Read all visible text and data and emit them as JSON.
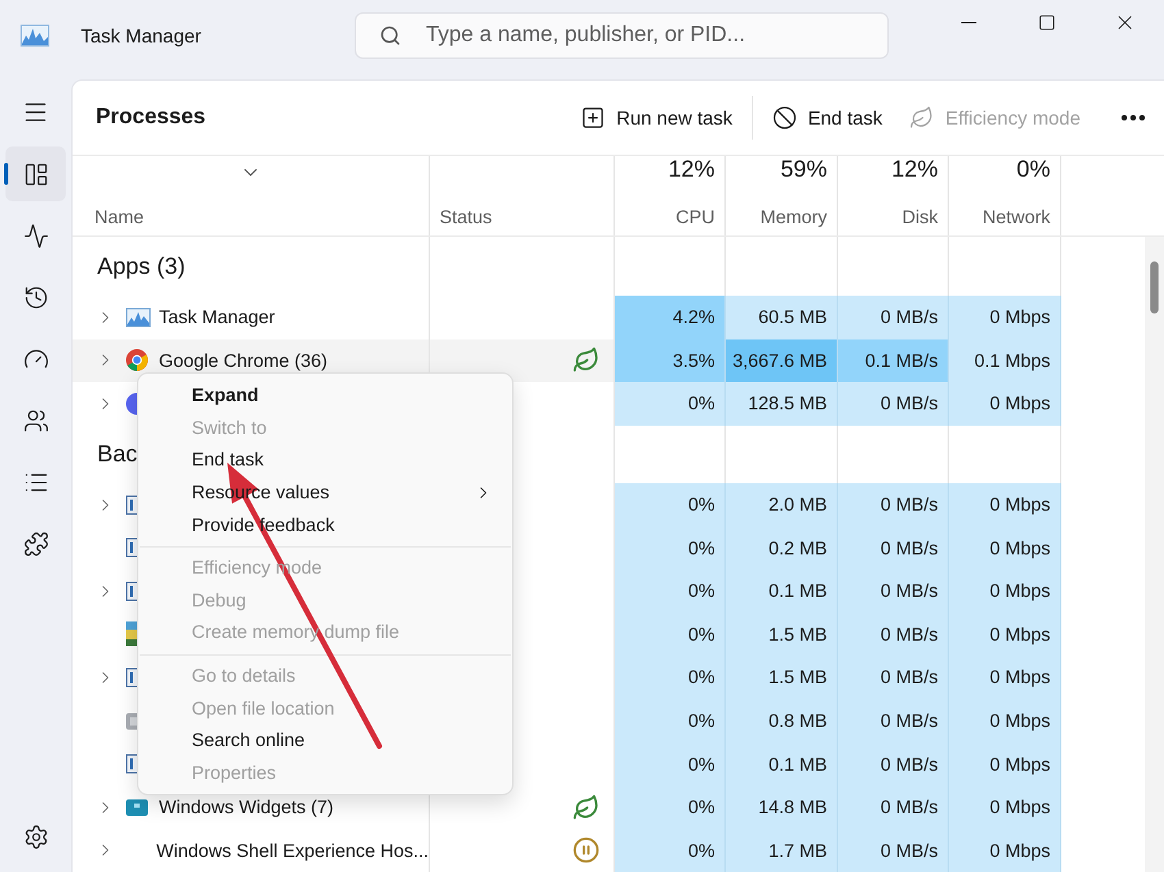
{
  "window": {
    "title": "Task Manager"
  },
  "search": {
    "placeholder": "Type a name, publisher, or PID..."
  },
  "sidebar": {
    "items": [
      {
        "kind": "processes",
        "selected": true
      },
      {
        "kind": "performance",
        "selected": false
      },
      {
        "kind": "history",
        "selected": false
      },
      {
        "kind": "startup",
        "selected": false
      },
      {
        "kind": "users",
        "selected": false
      },
      {
        "kind": "details",
        "selected": false
      },
      {
        "kind": "services",
        "selected": false
      }
    ]
  },
  "toolbar": {
    "title": "Processes",
    "actions": [
      {
        "kind": "run",
        "label": "Run new task",
        "disabled": false
      },
      {
        "kind": "end",
        "label": "End task",
        "disabled": false
      },
      {
        "kind": "efficiency",
        "label": "Efficiency mode",
        "disabled": true
      }
    ]
  },
  "table": {
    "columns": [
      {
        "kind": "name",
        "label": "Name"
      },
      {
        "kind": "status",
        "label": "Status"
      },
      {
        "kind": "metric",
        "percent": "12%",
        "label": "CPU"
      },
      {
        "kind": "metric",
        "percent": "59%",
        "label": "Memory"
      },
      {
        "kind": "metric",
        "percent": "12%",
        "label": "Disk"
      },
      {
        "kind": "metric",
        "percent": "0%",
        "label": "Network"
      }
    ],
    "rows": [
      {
        "kind": "group",
        "label": "Apps (3)"
      },
      {
        "kind": "process",
        "name": "Task Manager",
        "expandable": true,
        "selected": false,
        "efficiency_mode": false,
        "suspended": false,
        "cells": [
          {
            "text": "4.2%",
            "color": "#92d4fa"
          },
          {
            "text": "60.5 MB",
            "color": "#cbe9fb"
          },
          {
            "text": "0 MB/s",
            "color": "#cbe9fb"
          },
          {
            "text": "0 Mbps",
            "color": "#cbe9fb"
          }
        ]
      },
      {
        "kind": "process",
        "name": "Google Chrome (36)",
        "expandable": true,
        "selected": true,
        "efficiency_mode": true,
        "suspended": false,
        "cells": [
          {
            "text": "3.5%",
            "color": "#92d4fa"
          },
          {
            "text": "3,667.6 MB",
            "color": "#6ec5f6"
          },
          {
            "text": "0.1 MB/s",
            "color": "#92d4fa"
          },
          {
            "text": "0.1 Mbps",
            "color": "#cbe9fb"
          }
        ]
      },
      {
        "kind": "process",
        "expandable": true,
        "selected": false,
        "efficiency_mode": false,
        "suspended": false,
        "cells": [
          {
            "text": "0%",
            "color": "#cbe9fb"
          },
          {
            "text": "128.5 MB",
            "color": "#cbe9fb"
          },
          {
            "text": "0 MB/s",
            "color": "#cbe9fb"
          },
          {
            "text": "0 Mbps",
            "color": "#cbe9fb"
          }
        ]
      },
      {
        "kind": "group",
        "label": "Bac"
      },
      {
        "kind": "process",
        "expandable": true,
        "selected": false,
        "efficiency_mode": false,
        "suspended": false,
        "cells": [
          {
            "text": "0%",
            "color": "#cbe9fb"
          },
          {
            "text": "2.0 MB",
            "color": "#cbe9fb"
          },
          {
            "text": "0 MB/s",
            "color": "#cbe9fb"
          },
          {
            "text": "0 Mbps",
            "color": "#cbe9fb"
          }
        ]
      },
      {
        "kind": "process",
        "expandable": false,
        "selected": false,
        "efficiency_mode": false,
        "suspended": false,
        "cells": [
          {
            "text": "0%",
            "color": "#cbe9fb"
          },
          {
            "text": "0.2 MB",
            "color": "#cbe9fb"
          },
          {
            "text": "0 MB/s",
            "color": "#cbe9fb"
          },
          {
            "text": "0 Mbps",
            "color": "#cbe9fb"
          }
        ]
      },
      {
        "kind": "process",
        "expandable": true,
        "selected": false,
        "efficiency_mode": false,
        "suspended": false,
        "cells": [
          {
            "text": "0%",
            "color": "#cbe9fb"
          },
          {
            "text": "0.1 MB",
            "color": "#cbe9fb"
          },
          {
            "text": "0 MB/s",
            "color": "#cbe9fb"
          },
          {
            "text": "0 Mbps",
            "color": "#cbe9fb"
          }
        ]
      },
      {
        "kind": "process",
        "expandable": false,
        "selected": false,
        "efficiency_mode": false,
        "suspended": false,
        "cells": [
          {
            "text": "0%",
            "color": "#cbe9fb"
          },
          {
            "text": "1.5 MB",
            "color": "#cbe9fb"
          },
          {
            "text": "0 MB/s",
            "color": "#cbe9fb"
          },
          {
            "text": "0 Mbps",
            "color": "#cbe9fb"
          }
        ]
      },
      {
        "kind": "process",
        "expandable": true,
        "selected": false,
        "efficiency_mode": false,
        "suspended": false,
        "cells": [
          {
            "text": "0%",
            "color": "#cbe9fb"
          },
          {
            "text": "1.5 MB",
            "color": "#cbe9fb"
          },
          {
            "text": "0 MB/s",
            "color": "#cbe9fb"
          },
          {
            "text": "0 Mbps",
            "color": "#cbe9fb"
          }
        ]
      },
      {
        "kind": "process",
        "expandable": false,
        "selected": false,
        "efficiency_mode": false,
        "suspended": false,
        "cells": [
          {
            "text": "0%",
            "color": "#cbe9fb"
          },
          {
            "text": "0.8 MB",
            "color": "#cbe9fb"
          },
          {
            "text": "0 MB/s",
            "color": "#cbe9fb"
          },
          {
            "text": "0 Mbps",
            "color": "#cbe9fb"
          }
        ]
      },
      {
        "kind": "process",
        "expandable": false,
        "selected": false,
        "efficiency_mode": false,
        "suspended": false,
        "cells": [
          {
            "text": "0%",
            "color": "#cbe9fb"
          },
          {
            "text": "0.1 MB",
            "color": "#cbe9fb"
          },
          {
            "text": "0 MB/s",
            "color": "#cbe9fb"
          },
          {
            "text": "0 Mbps",
            "color": "#cbe9fb"
          }
        ]
      },
      {
        "kind": "process",
        "name": "Windows Widgets (7)",
        "expandable": true,
        "selected": false,
        "efficiency_mode": true,
        "suspended": false,
        "cells": [
          {
            "text": "0%",
            "color": "#cbe9fb"
          },
          {
            "text": "14.8 MB",
            "color": "#cbe9fb"
          },
          {
            "text": "0 MB/s",
            "color": "#cbe9fb"
          },
          {
            "text": "0 Mbps",
            "color": "#cbe9fb"
          }
        ]
      },
      {
        "kind": "process",
        "name": "Windows Shell Experience Hos...",
        "expandable": true,
        "selected": false,
        "efficiency_mode": false,
        "suspended": true,
        "cells": [
          {
            "text": "0%",
            "color": "#cbe9fb"
          },
          {
            "text": "1.7 MB",
            "color": "#cbe9fb"
          },
          {
            "text": "0 MB/s",
            "color": "#cbe9fb"
          },
          {
            "text": "0 Mbps",
            "color": "#cbe9fb"
          }
        ]
      }
    ]
  },
  "context_menu": {
    "items": [
      {
        "kind": "item",
        "label": "Expand",
        "default": true,
        "disabled": false
      },
      {
        "kind": "item",
        "label": "Switch to",
        "default": false,
        "disabled": true
      },
      {
        "kind": "item",
        "label": "End task",
        "default": false,
        "disabled": false
      },
      {
        "kind": "item",
        "label": "Resource values",
        "default": false,
        "disabled": false,
        "submenu": true
      },
      {
        "kind": "item",
        "label": "Provide feedback",
        "default": false,
        "disabled": false
      },
      {
        "kind": "separator"
      },
      {
        "kind": "item",
        "label": "Efficiency mode",
        "default": false,
        "disabled": true
      },
      {
        "kind": "item",
        "label": "Debug",
        "default": false,
        "disabled": true
      },
      {
        "kind": "item",
        "label": "Create memory dump file",
        "default": false,
        "disabled": true
      },
      {
        "kind": "separator"
      },
      {
        "kind": "item",
        "label": "Go to details",
        "default": false,
        "disabled": true
      },
      {
        "kind": "item",
        "label": "Open file location",
        "default": false,
        "disabled": true
      },
      {
        "kind": "item",
        "label": "Search online",
        "default": false,
        "disabled": false
      },
      {
        "kind": "item",
        "label": "Properties",
        "default": false,
        "disabled": true
      }
    ]
  }
}
